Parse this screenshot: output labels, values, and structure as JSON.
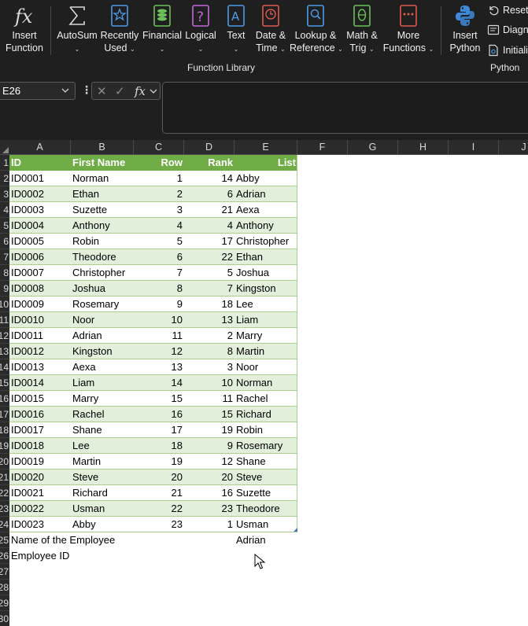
{
  "ribbon": {
    "buttons": [
      {
        "id": "insert-function",
        "line1": "Insert",
        "line2": "Function",
        "chevron": false,
        "icon": "fx-icon"
      },
      {
        "id": "autosum",
        "line1": "AutoSum",
        "line2": "",
        "chevron": true,
        "icon": "sigma-icon"
      },
      {
        "id": "recently-used",
        "line1": "Recently",
        "line2": "Used",
        "chevron": true,
        "icon": "star-book-icon"
      },
      {
        "id": "financial",
        "line1": "Financial",
        "line2": "",
        "chevron": true,
        "icon": "coins-book-icon"
      },
      {
        "id": "logical",
        "line1": "Logical",
        "line2": "",
        "chevron": true,
        "icon": "question-book-icon"
      },
      {
        "id": "text",
        "line1": "Text",
        "line2": "",
        "chevron": true,
        "icon": "text-book-icon"
      },
      {
        "id": "date-time",
        "line1": "Date &",
        "line2": "Time",
        "chevron": true,
        "icon": "clock-book-icon"
      },
      {
        "id": "lookup-reference",
        "line1": "Lookup &",
        "line2": "Reference",
        "chevron": true,
        "icon": "magnifier-book-icon"
      },
      {
        "id": "math-trig",
        "line1": "Math &",
        "line2": "Trig",
        "chevron": true,
        "icon": "theta-book-icon"
      },
      {
        "id": "more-functions",
        "line1": "More",
        "line2": "Functions",
        "chevron": true,
        "icon": "ellipsis-book-icon"
      },
      {
        "id": "insert-python",
        "line1": "Insert",
        "line2": "Python",
        "chevron": false,
        "icon": "python-icon"
      }
    ],
    "small_buttons": [
      "Reset",
      "Diagn",
      "Initiali"
    ],
    "groups": {
      "function_library": "Function Library",
      "python": "Python"
    },
    "chevron_glyph": "⌄"
  },
  "formula_bar": {
    "name_box": "E26",
    "cancel_glyph": "✕",
    "enter_glyph": "✓",
    "fx_glyph": "fx",
    "value": ""
  },
  "grid": {
    "columns": [
      "A",
      "B",
      "C",
      "D",
      "E",
      "F",
      "G",
      "H",
      "I",
      "J"
    ],
    "row_numbers": [
      "1",
      "2",
      "3",
      "4",
      "5",
      "6",
      "7",
      "8",
      "9",
      "10",
      "11",
      "12",
      "13",
      "14",
      "15",
      "16",
      "17",
      "18",
      "19",
      "20",
      "21",
      "22",
      "23",
      "24",
      "25",
      "26",
      "27",
      "28",
      "29",
      "30"
    ],
    "table": {
      "headers": [
        "ID",
        "First Name",
        "Row",
        "Rank",
        "List"
      ],
      "rows": [
        [
          "ID0001",
          "Norman",
          "1",
          "14",
          "Abby"
        ],
        [
          "ID0002",
          "Ethan",
          "2",
          "6",
          "Adrian"
        ],
        [
          "ID0003",
          "Suzette",
          "3",
          "21",
          "Aexa"
        ],
        [
          "ID0004",
          "Anthony",
          "4",
          "4",
          "Anthony"
        ],
        [
          "ID0005",
          "Robin",
          "5",
          "17",
          "Christopher"
        ],
        [
          "ID0006",
          "Theodore",
          "6",
          "22",
          "Ethan"
        ],
        [
          "ID0007",
          "Christopher",
          "7",
          "5",
          "Joshua"
        ],
        [
          "ID0008",
          "Joshua",
          "8",
          "7",
          "Kingston"
        ],
        [
          "ID0009",
          "Rosemary",
          "9",
          "18",
          "Lee"
        ],
        [
          "ID0010",
          "Noor",
          "10",
          "13",
          "Liam"
        ],
        [
          "ID0011",
          "Adrian",
          "11",
          "2",
          "Marry"
        ],
        [
          "ID0012",
          "Kingston",
          "12",
          "8",
          "Martin"
        ],
        [
          "ID0013",
          "Aexa",
          "13",
          "3",
          "Noor"
        ],
        [
          "ID0014",
          "Liam",
          "14",
          "10",
          "Norman"
        ],
        [
          "ID0015",
          "Marry",
          "15",
          "11",
          "Rachel"
        ],
        [
          "ID0016",
          "Rachel",
          "16",
          "15",
          "Richard"
        ],
        [
          "ID0017",
          "Shane",
          "17",
          "19",
          "Robin"
        ],
        [
          "ID0018",
          "Lee",
          "18",
          "9",
          "Rosemary"
        ],
        [
          "ID0019",
          "Martin",
          "19",
          "12",
          "Shane"
        ],
        [
          "ID0020",
          "Steve",
          "20",
          "20",
          "Steve"
        ],
        [
          "ID0021",
          "Richard",
          "21",
          "16",
          "Suzette"
        ],
        [
          "ID0022",
          "Usman",
          "22",
          "23",
          "Theodore"
        ],
        [
          "ID0023",
          "Abby",
          "23",
          "1",
          "Usman"
        ]
      ]
    },
    "extra_rows": [
      {
        "a": "Name of the Employee",
        "e": "Adrian"
      },
      {
        "a": "Employee ID",
        "e": ""
      }
    ]
  },
  "colors": {
    "ribbon_bg": "#1f1f1f",
    "table_header": "#70ad47",
    "table_band": "#e2efda",
    "table_line": "#a9d08e"
  }
}
